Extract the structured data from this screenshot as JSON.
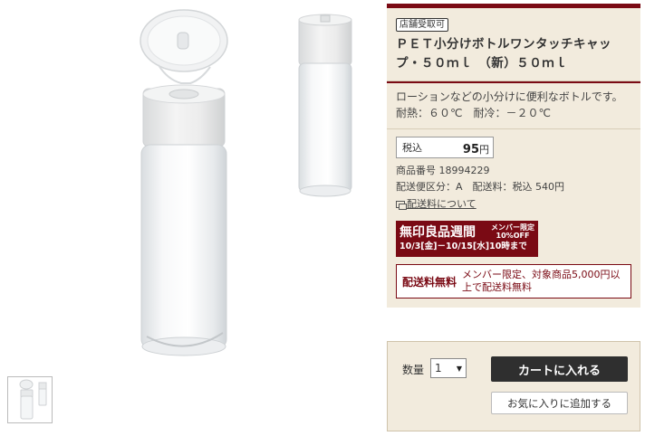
{
  "product": {
    "store_badge": "店舗受取可",
    "title": "ＰＥＴ小分けボトルワンタッチキャップ・５０ｍｌ　（新）５０ｍｌ",
    "description": "ローションなどの小分けに便利なボトルです。耐熱：６０℃　耐冷：－２０℃"
  },
  "price": {
    "label": "税込",
    "value": "95",
    "unit": "円"
  },
  "meta": {
    "item_number": "商品番号 18994229",
    "shipping_class": "配送便区分：A　配送料：税込 540円",
    "shipping_link": "配送料について"
  },
  "promo": {
    "title": "無印良品週間",
    "side_line1": "メンバー限定",
    "side_line2": "10%OFF",
    "dates": "10/3[金]－10/15[水]10時まで"
  },
  "free_shipping": {
    "label": "配送料無料",
    "text": "メンバー限定、対象商品5,000円以上で配送料無料"
  },
  "cart": {
    "qty_label": "数量",
    "qty_value": "1",
    "add_to_cart": "カートに入れる",
    "add_to_favorites": "お気に入りに追加する"
  },
  "colors": {
    "accent": "#7a0a14",
    "panel_bg": "#f2ebdd",
    "button_dark": "#2f2f2f"
  }
}
